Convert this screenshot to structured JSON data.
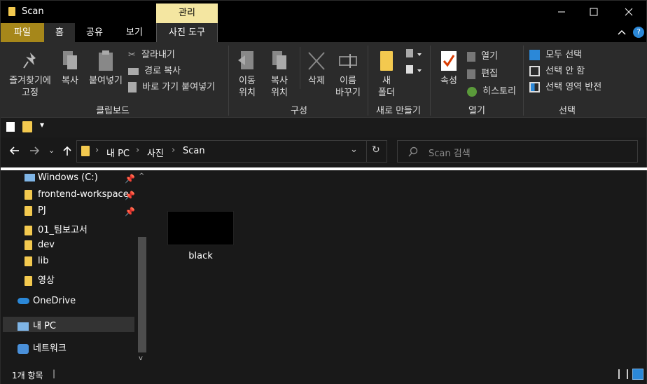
{
  "window": {
    "title": "Scan",
    "context_group": "관리"
  },
  "tabs": {
    "file": "파일",
    "home": "홈",
    "share": "공유",
    "view": "보기",
    "photo_tools": "사진 도구"
  },
  "ribbon": {
    "clipboard": {
      "pin": "즐겨찾기에\n고정",
      "copy": "복사",
      "paste": "붙여넣기",
      "cut": "잘라내기",
      "copy_path": "경로 복사",
      "paste_shortcut": "바로 가기 붙여넣기",
      "label": "클립보드"
    },
    "organize": {
      "move_to": "이동\n위치",
      "copy_to": "복사\n위치",
      "delete": "삭제",
      "rename": "이름\n바꾸기",
      "label": "구성"
    },
    "new": {
      "new_folder": "새\n폴더",
      "label": "새로 만들기"
    },
    "open": {
      "properties": "속성",
      "open": "열기",
      "edit": "편집",
      "history": "히스토리",
      "label": "열기"
    },
    "select": {
      "select_all": "모두 선택",
      "select_none": "선택 안 함",
      "invert": "선택 영역 반전",
      "label": "선택"
    }
  },
  "address": {
    "crumbs": [
      "내 PC",
      "사진",
      "Scan"
    ],
    "search_placeholder": "Scan 검색"
  },
  "nav": {
    "items": [
      {
        "label": "Windows (C:)",
        "pinned": true
      },
      {
        "label": "frontend-workspace",
        "pinned": true
      },
      {
        "label": "PJ",
        "pinned": true
      },
      {
        "label": "01_팀보고서"
      },
      {
        "label": "dev"
      },
      {
        "label": "lib"
      },
      {
        "label": "영상"
      }
    ],
    "onedrive": "OneDrive",
    "thispc": "내 PC",
    "network": "네트워크"
  },
  "files": [
    {
      "name": "black"
    }
  ],
  "status": {
    "count": "1개 항목"
  },
  "colors": {
    "folder": "#f3c94f",
    "file_tab": "#a6871a",
    "context": "#f4e6a1"
  }
}
